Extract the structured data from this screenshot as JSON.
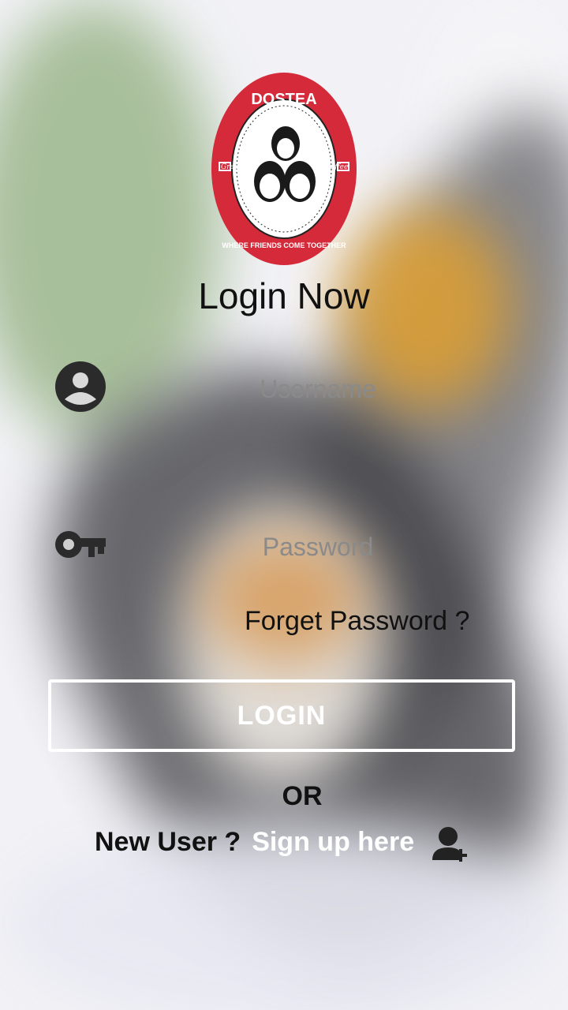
{
  "brand": {
    "name": "DOSTEA",
    "tagline": "WHERE FRIENDS COME TOGETHER",
    "small_left": "Great",
    "small_right": "Coffee"
  },
  "login": {
    "title": "Login Now",
    "username_placeholder": "Username",
    "username_value": "",
    "password_placeholder": "Password",
    "password_value": "",
    "forgot_label": "Forget Password ?",
    "login_button": "LOGIN",
    "or_text": "OR",
    "new_user_text": "New User ?",
    "signup_link": "Sign up here"
  },
  "icons": {
    "username": "account-circle-icon",
    "password": "key-icon",
    "signup": "person-add-icon"
  },
  "colors": {
    "logo_red": "#d42a3a",
    "text_dark": "#111111",
    "placeholder": "#8a8a8a",
    "button_border": "#ffffff"
  }
}
